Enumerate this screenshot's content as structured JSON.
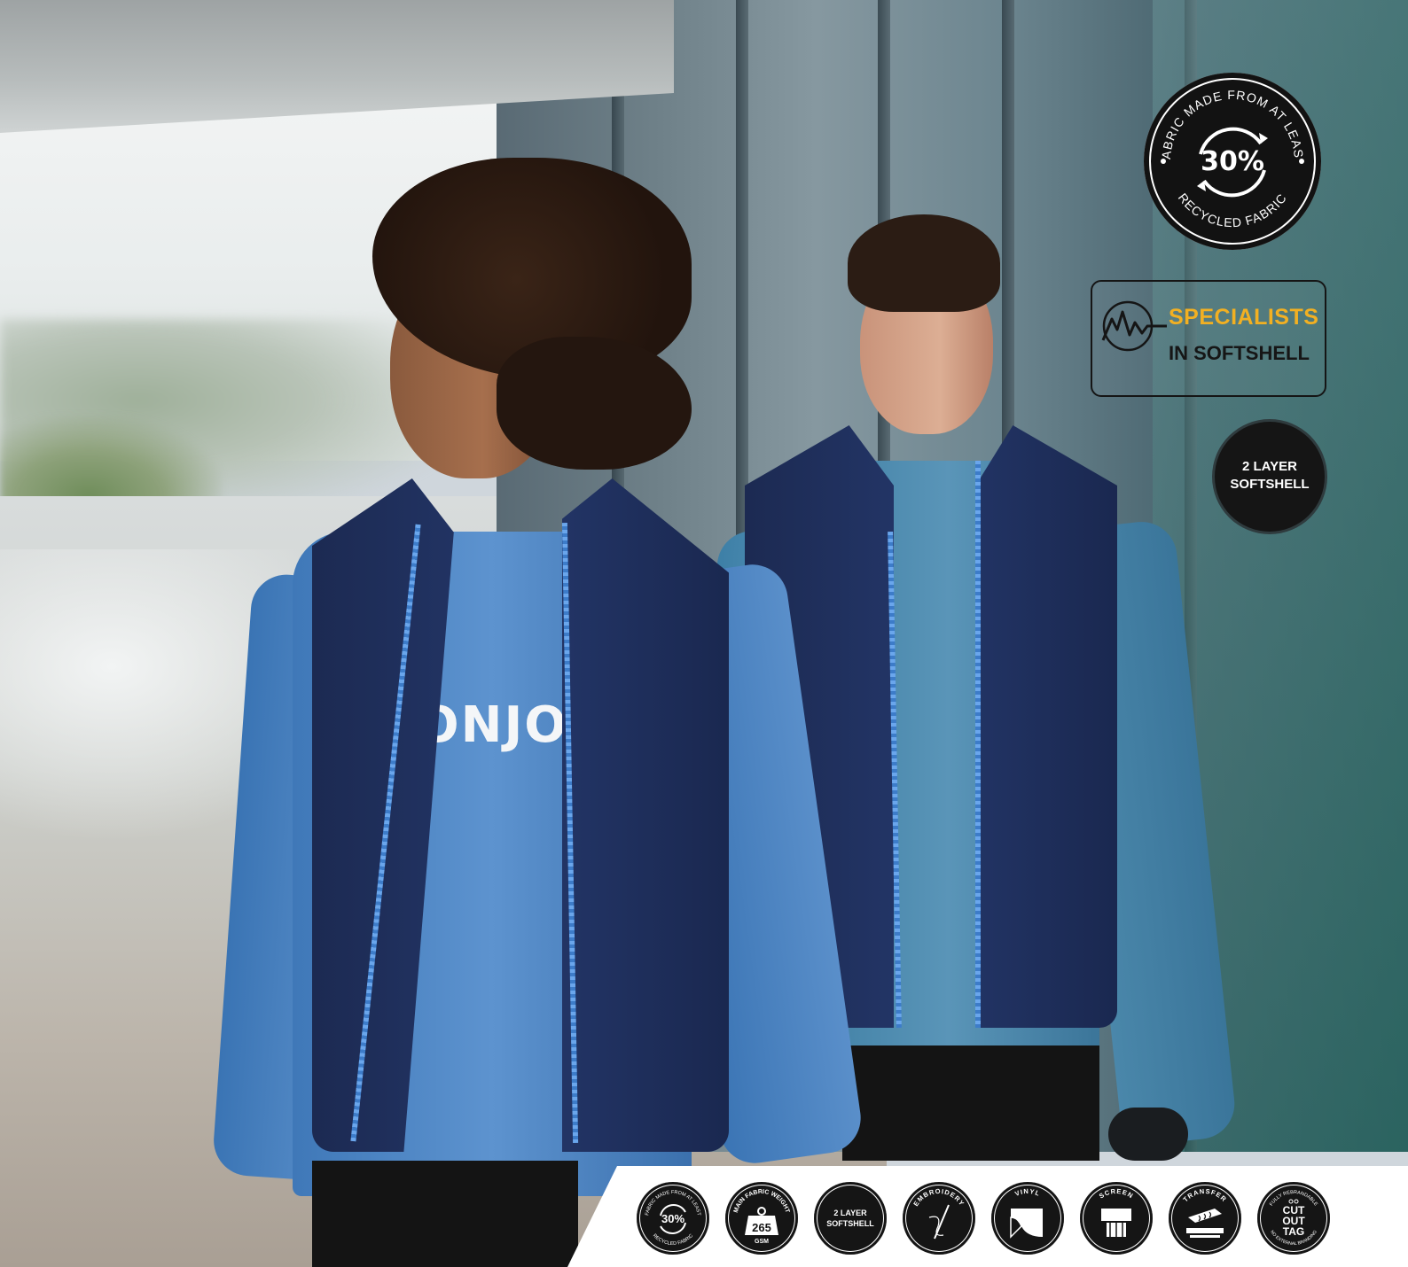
{
  "photo": {
    "front_sweater_text": "ONJO"
  },
  "badges": {
    "recycled": {
      "arc_top": "FABRIC MADE FROM AT LEAST",
      "arc_bottom": "RECYCLED FABRIC",
      "percent": "30%"
    },
    "specialists": {
      "line1": "SPECIALISTS",
      "line2": "IN SOFTSHELL",
      "accent_color": "#f2b022"
    },
    "layer": {
      "line1": "2 LAYER",
      "line2": "SOFTSHELL"
    }
  },
  "feature_strip": {
    "recycled": {
      "arc_top": "FABRIC MADE FROM AT LEAST",
      "arc_bottom": "RECYCLED FABRIC",
      "percent": "30%"
    },
    "weight": {
      "arc_top": "MAIN FABRIC WEIGHT",
      "value": "265",
      "unit": "GSM",
      "icon": "weight-icon"
    },
    "layer": {
      "line1": "2 LAYER",
      "line2": "SOFTSHELL"
    },
    "embroidery": {
      "arc_top": "EMBROIDERY",
      "icon": "needle-icon"
    },
    "vinyl": {
      "arc_top": "VINYL",
      "icon": "vinyl-icon"
    },
    "screen": {
      "arc_top": "SCREEN",
      "icon": "screen-print-icon"
    },
    "transfer": {
      "arc_top": "TRANSFER",
      "icon": "heat-press-icon"
    },
    "tag": {
      "arc_top": "FULLY REBRANDABLE",
      "arc_bottom": "NO EXTERNAL BRANDING",
      "line1": "CUT",
      "line2": "OUT",
      "line3": "TAG",
      "icon": "scissors-icon"
    }
  }
}
